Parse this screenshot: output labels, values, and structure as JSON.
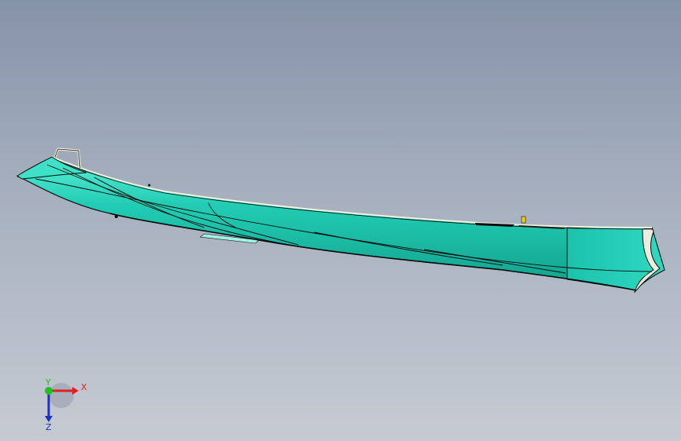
{
  "viewport": {
    "background_top": "#8593a8",
    "background_bottom": "#c6cbd3"
  },
  "model": {
    "hull_color": "#1ec8b0",
    "hull_highlight": "#3ee0c8",
    "hull_shadow": "#139a88",
    "edge_color": "#0a0a0a",
    "trim_color": "#f2f2dc",
    "accent_color": "#e8d020"
  },
  "triad": {
    "x_label": "X",
    "y_label": "Y",
    "z_label": "Z",
    "x_color": "#e02020",
    "y_color": "#20c020",
    "z_color": "#2030c0"
  }
}
